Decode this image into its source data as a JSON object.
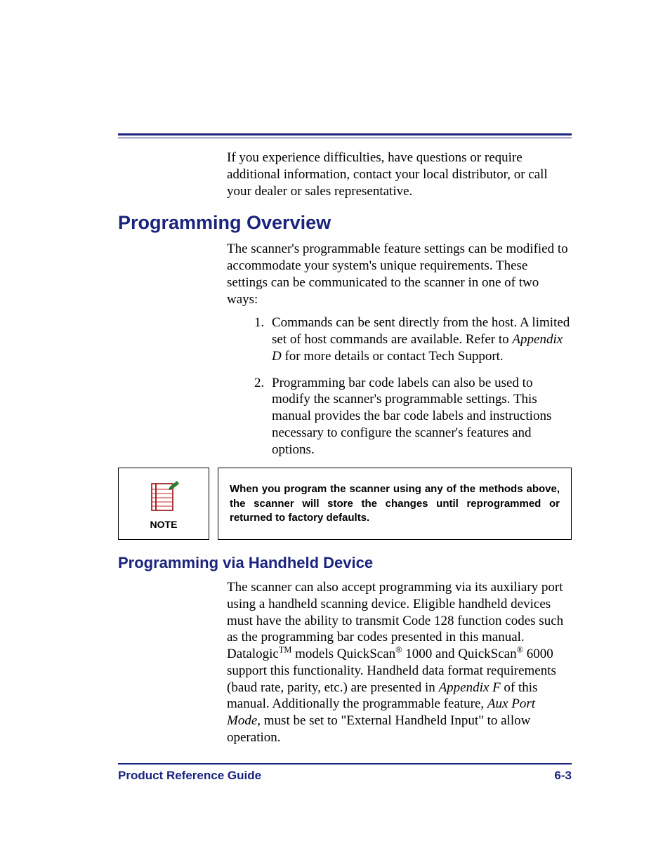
{
  "intro_para": "If you experience difficulties, have questions or require additional information, contact your local distributor, or call your dealer or sales representative.",
  "heading1": "Programming Overview",
  "overview_para": "The scanner's programmable feature settings can be modified to accommodate your system's unique requirements. These settings can be communicated to the scanner in one of two ways:",
  "list": {
    "item1_a": "Commands can be sent directly from the host. A limited set of host commands are available. Refer to ",
    "item1_b": "Appendix D",
    "item1_c": " for more details or contact Tech Support.",
    "item2": "Programming bar code labels can also be used to modify the scanner's programmable settings. This manual provides the bar code labels and instructions necessary to configure the scanner's features and options."
  },
  "note": {
    "label": "NOTE",
    "text": "When you program the scanner using any of the methods above, the scanner will store the changes until reprogrammed or returned to factory defaults."
  },
  "heading2": "Programming via Handheld Device",
  "hh": {
    "a": "The scanner can also accept programming via its auxiliary port using a handheld scanning device. Eligible handheld devices must have the ability to transmit Code 128 function codes such as the programming bar codes presented in this manual. Datalogic",
    "tm": "TM",
    "b": " models QuickScan",
    "reg": "®",
    "c": " 1000 and QuickScan",
    "d": " 6000 support this functionality. Handheld data format requirements (baud rate, parity, etc.) are presented in ",
    "appF": "Appendix F",
    "e": " of this manual. Additionally the programmable feature, ",
    "aux": "Aux Port Mode",
    "f": ", must be set to \"External Handheld Input\" to allow operation."
  },
  "footer": {
    "left": "Product Reference Guide",
    "right": "6-3"
  }
}
